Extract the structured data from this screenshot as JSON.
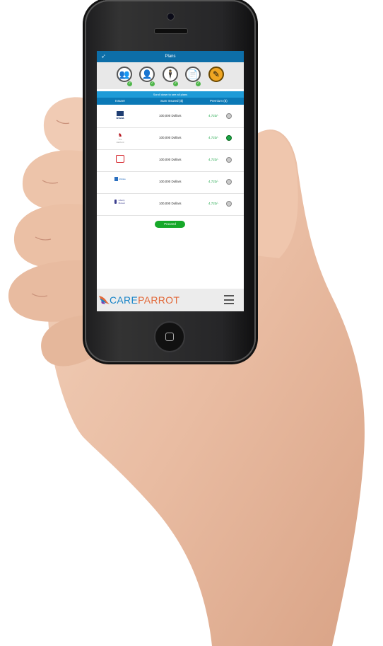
{
  "header": {
    "title": "Plans",
    "logo_icon": "bird-logo-icon"
  },
  "steps": [
    {
      "icon": "group-icon",
      "glyph": "👥",
      "done": true
    },
    {
      "icon": "user-icon",
      "glyph": "👤",
      "done": true
    },
    {
      "icon": "person-standing-icon",
      "glyph": "🕴",
      "done": true
    },
    {
      "icon": "document-list-icon",
      "glyph": "📄",
      "done": true
    },
    {
      "icon": "edit-icon",
      "glyph": "✎",
      "done": false,
      "active": true
    }
  ],
  "info_text": "Scroll down to see all plans",
  "table": {
    "columns": [
      "Insurer",
      "Sum Insured ($)",
      "Premium ($)"
    ],
    "rows": [
      {
        "logo": "USAA",
        "sum": "100,000 Dollars",
        "premium": "4,723/-",
        "selected": false
      },
      {
        "logo": "The Hartford",
        "sum": "100,000 Dollars",
        "premium": "4,723/-",
        "selected": true
      },
      {
        "logo": "State Farm",
        "sum": "100,000 Dollars",
        "premium": "4,723/-",
        "selected": false
      },
      {
        "logo": "Allstate",
        "sum": "100,000 Dollars",
        "premium": "4,723/-",
        "selected": false
      },
      {
        "logo": "Liberty Mutual",
        "sum": "100,000 Dollars",
        "premium": "4,723/-",
        "selected": false
      }
    ]
  },
  "proceed_label": "Proceed",
  "footer": {
    "brand_care": "CARE",
    "brand_parrot": "PARROT",
    "menu_icon": "hamburger-menu-icon"
  },
  "colors": {
    "primary": "#0d6ea8",
    "accent": "#f0a623",
    "success": "#16a829",
    "brand_orange": "#e26a3b"
  }
}
